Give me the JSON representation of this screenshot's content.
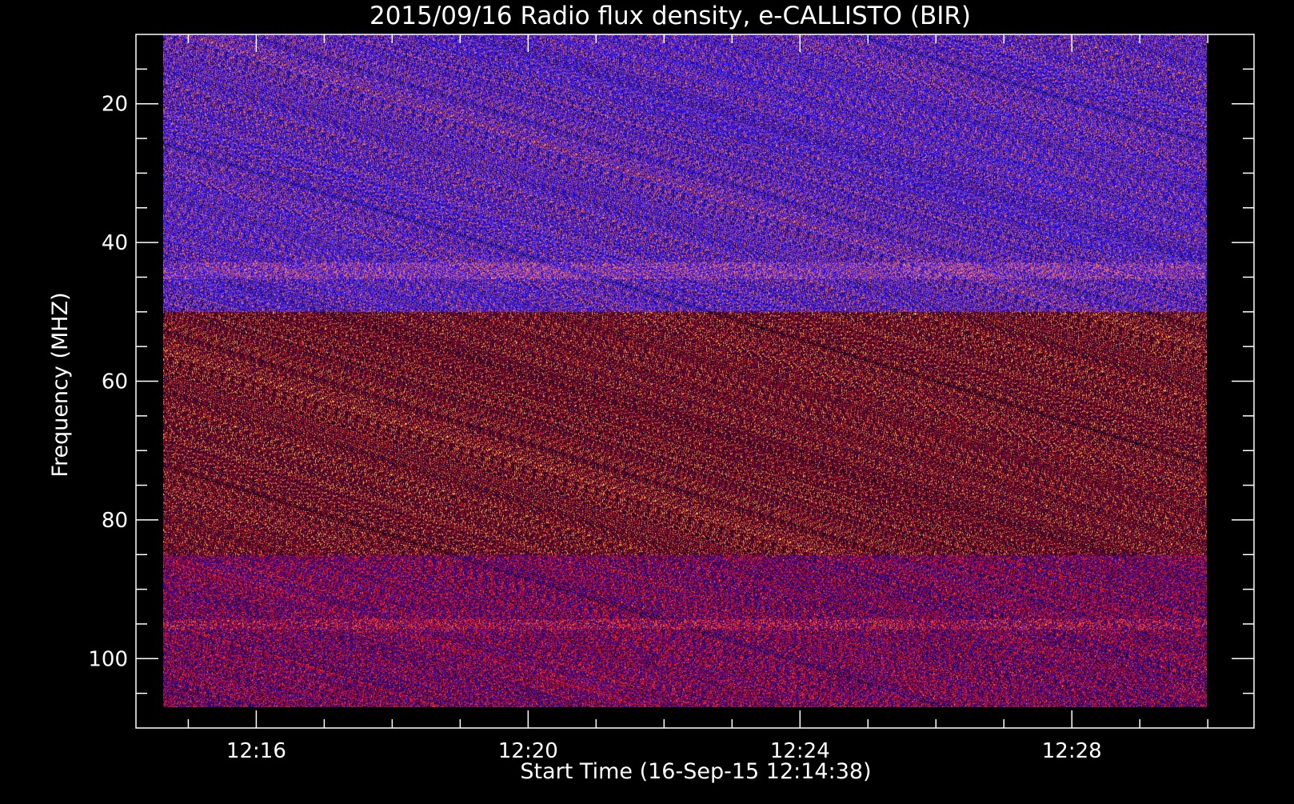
{
  "chart_data": {
    "type": "heatmap",
    "title": "2015/09/16  Radio flux density, e-CALLISTO (BIR)",
    "xlabel": "Start Time (16-Sep-15 12:14:38)",
    "ylabel": "Frequency (MHZ)",
    "x_axis": {
      "ticks": [
        "12:16",
        "12:20",
        "12:24",
        "12:28"
      ],
      "tick_minutes": [
        16,
        20,
        24,
        28
      ],
      "range_minutes": [
        14.23,
        30.68
      ],
      "data_range_minutes": [
        14.63,
        29.98
      ],
      "minor_step_minutes": 1
    },
    "y_axis": {
      "ticks": [
        "20",
        "40",
        "60",
        "80",
        "100"
      ],
      "tick_values": [
        20,
        40,
        60,
        80,
        100
      ],
      "range": [
        10,
        110
      ],
      "data_range": [
        10,
        107
      ],
      "minor_step": 5,
      "inverted": true
    },
    "grid": false,
    "colorbar": false,
    "colormap": [
      "#000000",
      "#1a0a5a",
      "#2a10c8",
      "#5a30ff",
      "#8a0a2a",
      "#d01010",
      "#ff3020",
      "#ff9a50",
      "#ffd070"
    ],
    "frequency_bands": [
      {
        "from": 10,
        "to": 50,
        "dominant": "blue/violet",
        "relative_intensity": 0.75
      },
      {
        "from": 50,
        "to": 85,
        "dominant": "dark red/black",
        "relative_intensity": 0.45
      },
      {
        "from": 85,
        "to": 107,
        "dominant": "red/blue",
        "relative_intensity": 0.7
      }
    ],
    "notes": "Noise-like background spectrogram with no distinct burst; horizontal bright lines near 44 MHz and 95 MHz."
  },
  "colors": {
    "background": "#000000",
    "axis": "#ffffff",
    "text": "#ffffff"
  }
}
